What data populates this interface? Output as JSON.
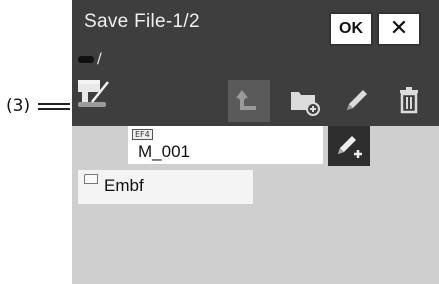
{
  "callout": {
    "label": "(3)"
  },
  "window": {
    "title": "Save File-1/2"
  },
  "buttons": {
    "ok_label": "OK",
    "close_label": "✕"
  },
  "path": {
    "separator": "/"
  },
  "toolbar": {
    "icons": [
      "sewing-machine-drive-icon",
      "parent-folder-icon",
      "new-folder-icon",
      "pencil-icon",
      "trash-icon"
    ]
  },
  "file_list": {
    "file": {
      "tag": "EF4",
      "name": "M_001"
    },
    "folder": {
      "name": "Embf"
    }
  },
  "colors": {
    "bar": "#3e3e3e",
    "screen_bg": "#cfcfcf",
    "entry_bg": "#ffffff"
  }
}
